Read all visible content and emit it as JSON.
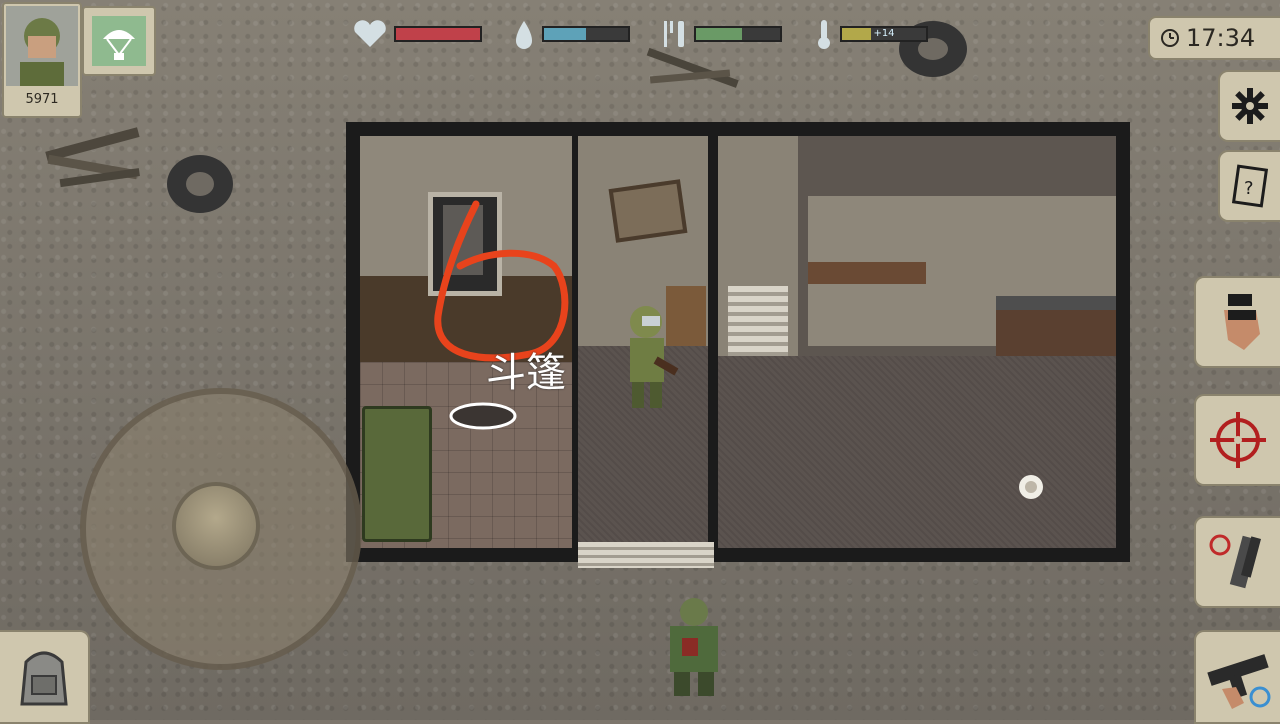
{
  "player": {
    "score": "5971"
  },
  "stats": {
    "health": {
      "icon": "heart-icon",
      "fill": 1.0,
      "color": "#c0414a"
    },
    "thirst": {
      "icon": "water-drop-icon",
      "fill": 0.5,
      "color": "#5ea2b8"
    },
    "hunger": {
      "icon": "fork-knife-icon",
      "fill": 0.55,
      "color": "#6a9a66"
    },
    "temperature": {
      "icon": "thermometer-icon",
      "fill": 0.35,
      "color": "#b2a84a",
      "value": "+14"
    }
  },
  "clock": {
    "time": "17:34"
  },
  "scene": {
    "item_label": "斗篷"
  },
  "buttons": {
    "settings": "gear-icon",
    "journal": "notebook-icon",
    "grab": "hand-icon",
    "aim": "crosshair-icon",
    "swap_weapon": "swap-weapon-icon",
    "weapon": "rifle-icon",
    "inventory": "backpack-icon",
    "airdrop": "parachute-icon"
  }
}
